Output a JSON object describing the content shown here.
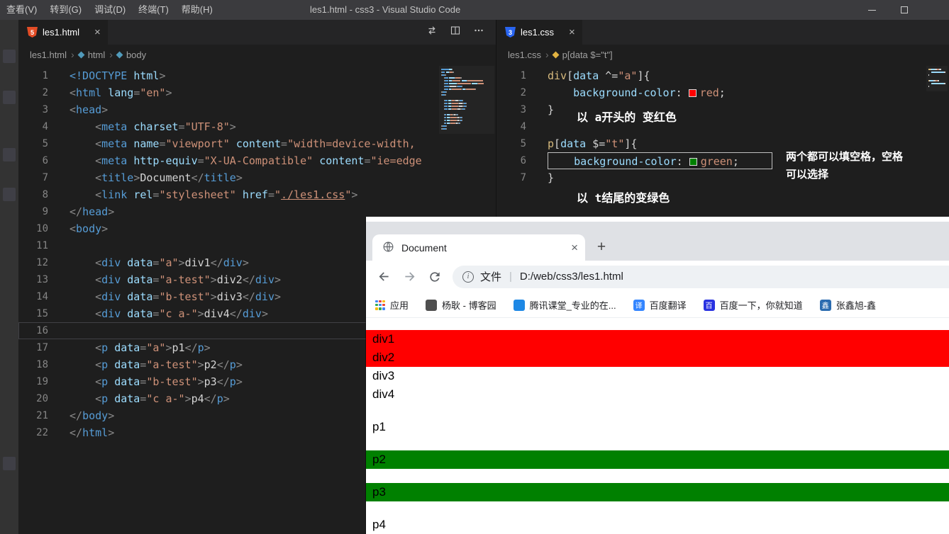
{
  "titlebar": {
    "menus": [
      "查看(V)",
      "转到(G)",
      "调试(D)",
      "终端(T)",
      "帮助(H)"
    ],
    "title": "les1.html - css3 - Visual Studio Code"
  },
  "ui": {
    "close_glyph": "×",
    "plus_glyph": "+",
    "info_glyph": "i"
  },
  "left_editor": {
    "tab_label": "les1.html",
    "tab_icon": "5",
    "breadcrumb": {
      "file": "les1.html",
      "node1": "html",
      "node2": "body"
    },
    "lines": [
      {
        "n": 1,
        "tokens": [
          [
            "<!DOCTYPE ",
            "tag"
          ],
          [
            "html",
            "attr"
          ],
          [
            ">",
            "pun"
          ]
        ]
      },
      {
        "n": 2,
        "tokens": [
          [
            "<",
            "pun"
          ],
          [
            "html",
            "tag"
          ],
          [
            " ",
            "txt"
          ],
          [
            "lang",
            "attr"
          ],
          [
            "=",
            "pun"
          ],
          [
            "\"en\"",
            "str"
          ],
          [
            ">",
            "pun"
          ]
        ]
      },
      {
        "n": 3,
        "tokens": [
          [
            "<",
            "pun"
          ],
          [
            "head",
            "tag"
          ],
          [
            ">",
            "pun"
          ]
        ]
      },
      {
        "n": 4,
        "tokens": [
          [
            "    ",
            "txt"
          ],
          [
            "<",
            "pun"
          ],
          [
            "meta",
            "tag"
          ],
          [
            " ",
            "txt"
          ],
          [
            "charset",
            "attr"
          ],
          [
            "=",
            "pun"
          ],
          [
            "\"UTF-8\"",
            "str"
          ],
          [
            ">",
            "pun"
          ]
        ]
      },
      {
        "n": 5,
        "tokens": [
          [
            "    ",
            "txt"
          ],
          [
            "<",
            "pun"
          ],
          [
            "meta",
            "tag"
          ],
          [
            " ",
            "txt"
          ],
          [
            "name",
            "attr"
          ],
          [
            "=",
            "pun"
          ],
          [
            "\"viewport\"",
            "str"
          ],
          [
            " ",
            "txt"
          ],
          [
            "content",
            "attr"
          ],
          [
            "=",
            "pun"
          ],
          [
            "\"width=device-width,",
            "str"
          ]
        ]
      },
      {
        "n": 6,
        "tokens": [
          [
            "    ",
            "txt"
          ],
          [
            "<",
            "pun"
          ],
          [
            "meta",
            "tag"
          ],
          [
            " ",
            "txt"
          ],
          [
            "http-equiv",
            "attr"
          ],
          [
            "=",
            "pun"
          ],
          [
            "\"X-UA-Compatible\"",
            "str"
          ],
          [
            " ",
            "txt"
          ],
          [
            "content",
            "attr"
          ],
          [
            "=",
            "pun"
          ],
          [
            "\"ie=edge",
            "str"
          ]
        ]
      },
      {
        "n": 7,
        "tokens": [
          [
            "    ",
            "txt"
          ],
          [
            "<",
            "pun"
          ],
          [
            "title",
            "tag"
          ],
          [
            ">",
            "pun"
          ],
          [
            "Document",
            "txt"
          ],
          [
            "</",
            "pun"
          ],
          [
            "title",
            "tag"
          ],
          [
            ">",
            "pun"
          ]
        ]
      },
      {
        "n": 8,
        "tokens": [
          [
            "    ",
            "txt"
          ],
          [
            "<",
            "pun"
          ],
          [
            "link",
            "tag"
          ],
          [
            " ",
            "txt"
          ],
          [
            "rel",
            "attr"
          ],
          [
            "=",
            "pun"
          ],
          [
            "\"stylesheet\"",
            "str"
          ],
          [
            " ",
            "txt"
          ],
          [
            "href",
            "attr"
          ],
          [
            "=",
            "pun"
          ],
          [
            "\"",
            "str"
          ],
          [
            "./les1.css",
            "link"
          ],
          [
            "\"",
            "str"
          ],
          [
            ">",
            "pun"
          ]
        ]
      },
      {
        "n": 9,
        "tokens": [
          [
            "</",
            "pun"
          ],
          [
            "head",
            "tag"
          ],
          [
            ">",
            "pun"
          ]
        ]
      },
      {
        "n": 10,
        "tokens": [
          [
            "<",
            "pun"
          ],
          [
            "body",
            "tag"
          ],
          [
            ">",
            "pun"
          ]
        ]
      },
      {
        "n": 11,
        "tokens": []
      },
      {
        "n": 12,
        "tokens": [
          [
            "    ",
            "txt"
          ],
          [
            "<",
            "pun"
          ],
          [
            "div",
            "tag"
          ],
          [
            " ",
            "txt"
          ],
          [
            "data",
            "attr"
          ],
          [
            "=",
            "pun"
          ],
          [
            "\"a\"",
            "str"
          ],
          [
            ">",
            "pun"
          ],
          [
            "div1",
            "txt"
          ],
          [
            "</",
            "pun"
          ],
          [
            "div",
            "tag"
          ],
          [
            ">",
            "pun"
          ]
        ]
      },
      {
        "n": 13,
        "tokens": [
          [
            "    ",
            "txt"
          ],
          [
            "<",
            "pun"
          ],
          [
            "div",
            "tag"
          ],
          [
            " ",
            "txt"
          ],
          [
            "data",
            "attr"
          ],
          [
            "=",
            "pun"
          ],
          [
            "\"a-test\"",
            "str"
          ],
          [
            ">",
            "pun"
          ],
          [
            "div2",
            "txt"
          ],
          [
            "</",
            "pun"
          ],
          [
            "div",
            "tag"
          ],
          [
            ">",
            "pun"
          ]
        ]
      },
      {
        "n": 14,
        "tokens": [
          [
            "    ",
            "txt"
          ],
          [
            "<",
            "pun"
          ],
          [
            "div",
            "tag"
          ],
          [
            " ",
            "txt"
          ],
          [
            "data",
            "attr"
          ],
          [
            "=",
            "pun"
          ],
          [
            "\"b-test\"",
            "str"
          ],
          [
            ">",
            "pun"
          ],
          [
            "div3",
            "txt"
          ],
          [
            "</",
            "pun"
          ],
          [
            "div",
            "tag"
          ],
          [
            ">",
            "pun"
          ]
        ]
      },
      {
        "n": 15,
        "tokens": [
          [
            "    ",
            "txt"
          ],
          [
            "<",
            "pun"
          ],
          [
            "div",
            "tag"
          ],
          [
            " ",
            "txt"
          ],
          [
            "data",
            "attr"
          ],
          [
            "=",
            "pun"
          ],
          [
            "\"c a-\"",
            "str"
          ],
          [
            ">",
            "pun"
          ],
          [
            "div4",
            "txt"
          ],
          [
            "</",
            "pun"
          ],
          [
            "div",
            "tag"
          ],
          [
            ">",
            "pun"
          ]
        ]
      },
      {
        "n": 16,
        "tokens": [],
        "current": true
      },
      {
        "n": 17,
        "tokens": [
          [
            "    ",
            "txt"
          ],
          [
            "<",
            "pun"
          ],
          [
            "p",
            "tag"
          ],
          [
            " ",
            "txt"
          ],
          [
            "data",
            "attr"
          ],
          [
            "=",
            "pun"
          ],
          [
            "\"a\"",
            "str"
          ],
          [
            ">",
            "pun"
          ],
          [
            "p1",
            "txt"
          ],
          [
            "</",
            "pun"
          ],
          [
            "p",
            "tag"
          ],
          [
            ">",
            "pun"
          ]
        ]
      },
      {
        "n": 18,
        "tokens": [
          [
            "    ",
            "txt"
          ],
          [
            "<",
            "pun"
          ],
          [
            "p",
            "tag"
          ],
          [
            " ",
            "txt"
          ],
          [
            "data",
            "attr"
          ],
          [
            "=",
            "pun"
          ],
          [
            "\"a-test\"",
            "str"
          ],
          [
            ">",
            "pun"
          ],
          [
            "p2",
            "txt"
          ],
          [
            "</",
            "pun"
          ],
          [
            "p",
            "tag"
          ],
          [
            ">",
            "pun"
          ]
        ]
      },
      {
        "n": 19,
        "tokens": [
          [
            "    ",
            "txt"
          ],
          [
            "<",
            "pun"
          ],
          [
            "p",
            "tag"
          ],
          [
            " ",
            "txt"
          ],
          [
            "data",
            "attr"
          ],
          [
            "=",
            "pun"
          ],
          [
            "\"b-test\"",
            "str"
          ],
          [
            ">",
            "pun"
          ],
          [
            "p3",
            "txt"
          ],
          [
            "</",
            "pun"
          ],
          [
            "p",
            "tag"
          ],
          [
            ">",
            "pun"
          ]
        ]
      },
      {
        "n": 20,
        "tokens": [
          [
            "    ",
            "txt"
          ],
          [
            "<",
            "pun"
          ],
          [
            "p",
            "tag"
          ],
          [
            " ",
            "txt"
          ],
          [
            "data",
            "attr"
          ],
          [
            "=",
            "pun"
          ],
          [
            "\"c a-\"",
            "str"
          ],
          [
            ">",
            "pun"
          ],
          [
            "p4",
            "txt"
          ],
          [
            "</",
            "pun"
          ],
          [
            "p",
            "tag"
          ],
          [
            ">",
            "pun"
          ]
        ]
      },
      {
        "n": 21,
        "tokens": [
          [
            "</",
            "pun"
          ],
          [
            "body",
            "tag"
          ],
          [
            ">",
            "pun"
          ]
        ]
      },
      {
        "n": 22,
        "tokens": [
          [
            "</",
            "pun"
          ],
          [
            "html",
            "tag"
          ],
          [
            ">",
            "pun"
          ]
        ]
      }
    ]
  },
  "right_editor": {
    "tab_label": "les1.css",
    "tab_icon": "3",
    "breadcrumb": {
      "file": "les1.css",
      "node1": "p[data $=\"t\"]"
    },
    "lines": [
      {
        "n": 1,
        "tokens": [
          [
            "div",
            "sel"
          ],
          [
            "[",
            "txt"
          ],
          [
            "data",
            "attr"
          ],
          [
            " ^=",
            "txt"
          ],
          [
            "\"a\"",
            "str"
          ],
          [
            "]",
            "txt"
          ],
          [
            "{",
            "txt"
          ]
        ]
      },
      {
        "n": 2,
        "tokens": [
          [
            "    ",
            "txt"
          ],
          [
            "background-color",
            "attr"
          ],
          [
            ": ",
            "txt"
          ],
          [
            "#ff0000",
            "swatch"
          ],
          [
            "red",
            "str"
          ],
          [
            ";",
            "txt"
          ]
        ]
      },
      {
        "n": 3,
        "tokens": [
          [
            "}",
            "txt"
          ]
        ]
      },
      {
        "n": 4,
        "tokens": []
      },
      {
        "n": 5,
        "tokens": [
          [
            "p",
            "sel"
          ],
          [
            "[",
            "txt"
          ],
          [
            "data",
            "attr"
          ],
          [
            " $=",
            "txt"
          ],
          [
            "\"t\"",
            "str"
          ],
          [
            "]",
            "txt"
          ],
          [
            "{",
            "txt"
          ]
        ]
      },
      {
        "n": 6,
        "boxed": true,
        "tokens": [
          [
            "    ",
            "txt"
          ],
          [
            "background-color",
            "attr"
          ],
          [
            ": ",
            "txt"
          ],
          [
            "#008000",
            "swatch"
          ],
          [
            "green",
            "str"
          ],
          [
            ";",
            "txt"
          ]
        ]
      },
      {
        "n": 7,
        "tokens": [
          [
            "}",
            "txt"
          ]
        ]
      }
    ],
    "annotations": {
      "a1": "以 a开头的 变红色",
      "a2": "两个都可以填空格，空格",
      "a3": "可以选择",
      "a4": "以 t结尾的变绿色"
    }
  },
  "browser": {
    "tab_title": "Document",
    "address": {
      "prefix_label": "文件",
      "divider": "|",
      "url": "D:/web/css3/les1.html"
    },
    "bookmarks": [
      {
        "id": "apps",
        "label": "应用",
        "icon": "apps-grid-icon",
        "grid_colors": [
          "#4285f4",
          "#ea4335",
          "#fbbc05",
          "#34a853",
          "#4285f4",
          "#ea4335",
          "#fbbc05",
          "#34a853",
          "#4285f4"
        ]
      },
      {
        "id": "yanggeng-blog",
        "label": "杨耿 - 博客园",
        "icon": "blog-favicon",
        "color": "#4f4f4f",
        "glyph": ""
      },
      {
        "id": "tencent-classroom",
        "label": "腾讯课堂_专业的在...",
        "icon": "tencent-classroom-favicon",
        "color": "#1e88e5",
        "glyph": ""
      },
      {
        "id": "baidu-translate",
        "label": "百度翻译",
        "icon": "baidu-translate-favicon",
        "color": "#3385ff",
        "glyph": "译"
      },
      {
        "id": "baidu",
        "label": "百度一下，你就知道",
        "icon": "baidu-favicon",
        "color": "#2932e1",
        "glyph": "百"
      },
      {
        "id": "zhangxinxu",
        "label": "张鑫旭-鑫",
        "icon": "zhangxinxu-favicon",
        "color": "#2b6cb0",
        "glyph": "鑫"
      }
    ],
    "page_blocks": [
      {
        "text": "div1",
        "type": "div",
        "bg": "#ff0000"
      },
      {
        "text": "div2",
        "type": "div",
        "bg": "#ff0000"
      },
      {
        "text": "div3",
        "type": "div",
        "bg": ""
      },
      {
        "text": "div4",
        "type": "div",
        "bg": ""
      },
      {
        "text": "p1",
        "type": "p",
        "bg": ""
      },
      {
        "text": "p2",
        "type": "p",
        "bg": "#008000"
      },
      {
        "text": "p3",
        "type": "p",
        "bg": "#008000"
      },
      {
        "text": "p4",
        "type": "p",
        "bg": ""
      }
    ]
  }
}
